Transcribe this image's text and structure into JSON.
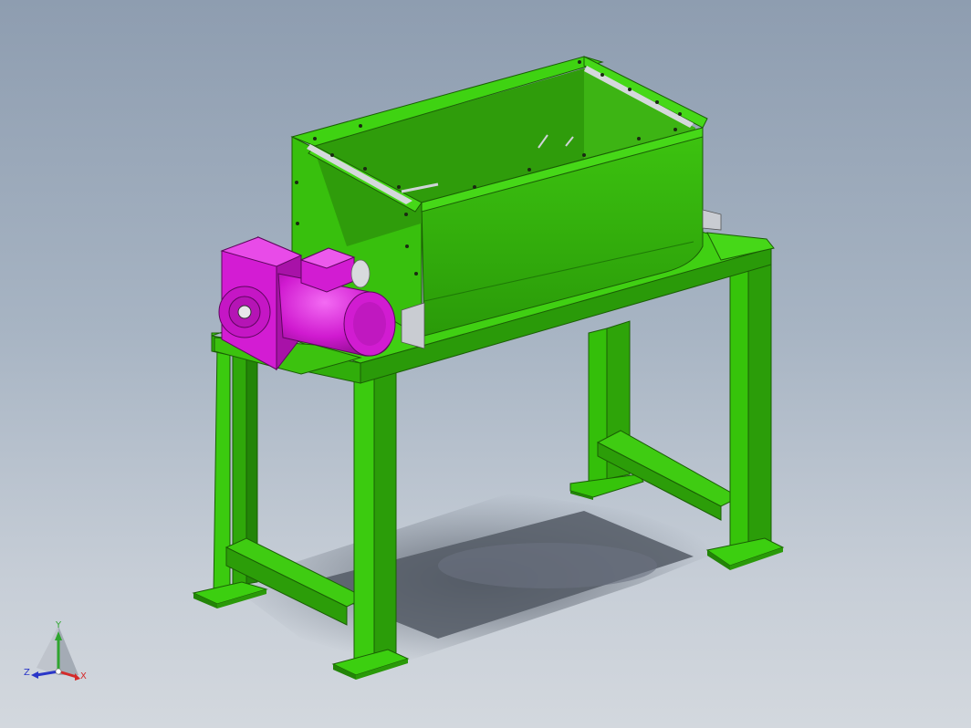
{
  "viewport": {
    "background_top": "#8e9db0",
    "background_bottom": "#d3d8de"
  },
  "model": {
    "frame_color": "#36c40a",
    "frame_dark": "#1f8a05",
    "hopper_color": "#33b10b",
    "hopper_inner": "#2b8f0a",
    "motor_color": "#d919d9",
    "motor_dark": "#9b0f9b",
    "shadow_color": "#5d6470",
    "steel_color": "#c9ccd2"
  },
  "triad": {
    "y_label": "Y",
    "z_label": "Z",
    "x_label": "X",
    "y_color": "#2fa52f",
    "z_color": "#2a36c8",
    "x_color": "#d42a2a"
  }
}
